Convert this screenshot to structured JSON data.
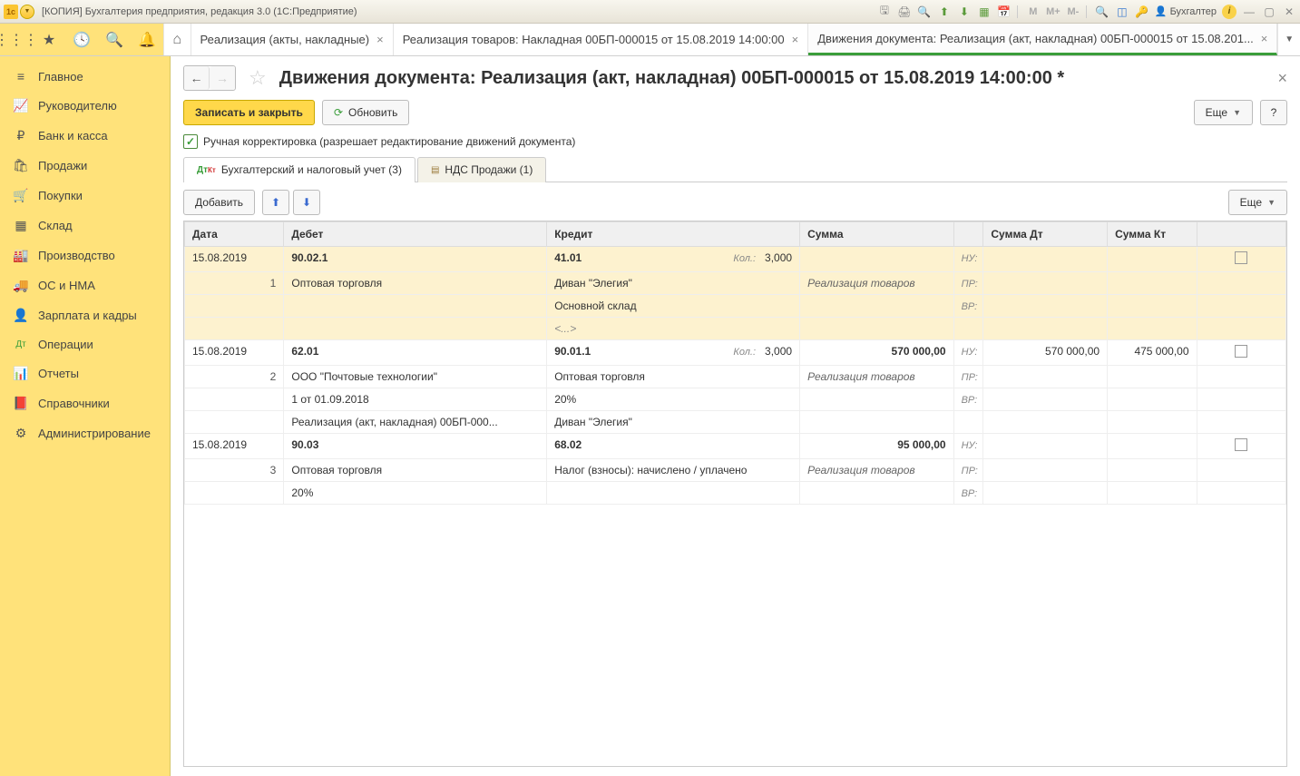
{
  "titlebar": {
    "title": "[КОПИЯ] Бухгалтерия предприятия, редакция 3.0  (1С:Предприятие)",
    "user": "Бухгалтер",
    "m_labels": [
      "M",
      "M+",
      "M-"
    ]
  },
  "open_tabs": [
    {
      "label": "Реализация (акты, накладные)",
      "closable": true
    },
    {
      "label": "Реализация товаров: Накладная 00БП-000015 от 15.08.2019 14:00:00",
      "closable": true
    },
    {
      "label": "Движения документа: Реализация (акт, накладная) 00БП-000015 от 15.08.201...",
      "closable": true,
      "active": true
    }
  ],
  "sidebar": [
    {
      "icon": "≡",
      "label": "Главное"
    },
    {
      "icon": "📈",
      "label": "Руководителю"
    },
    {
      "icon": "₽",
      "label": "Банк и касса"
    },
    {
      "icon": "🛍",
      "label": "Продажи"
    },
    {
      "icon": "🛒",
      "label": "Покупки"
    },
    {
      "icon": "▦",
      "label": "Склад"
    },
    {
      "icon": "🏭",
      "label": "Производство"
    },
    {
      "icon": "🚚",
      "label": "ОС и НМА"
    },
    {
      "icon": "👤",
      "label": "Зарплата и кадры"
    },
    {
      "icon": "Дт",
      "label": "Операции"
    },
    {
      "icon": "📊",
      "label": "Отчеты"
    },
    {
      "icon": "📕",
      "label": "Справочники"
    },
    {
      "icon": "⚙",
      "label": "Администрирование"
    }
  ],
  "page": {
    "title": "Движения документа: Реализация (акт, накладная) 00БП-000015 от 15.08.2019 14:00:00 *",
    "save_close": "Записать и закрыть",
    "refresh": "Обновить",
    "more": "Еще",
    "help": "?",
    "manual_edit": "Ручная корректировка (разрешает редактирование движений документа)",
    "subtabs": [
      "Бухгалтерский и налоговый учет (3)",
      "НДС Продажи (1)"
    ],
    "add": "Добавить"
  },
  "table": {
    "headers": {
      "date": "Дата",
      "debit": "Дебет",
      "credit": "Кредит",
      "sum": "Сумма",
      "sum_dt": "Сумма Дт",
      "sum_kt": "Сумма Кт"
    },
    "labels": {
      "kol": "Кол.:",
      "nu": "НУ:",
      "pr": "ПР:",
      "vr": "ВР:",
      "dots": "<...>"
    },
    "rows": [
      {
        "selected": true,
        "date": "15.08.2019",
        "num": "1",
        "dr_acc": "90.02.1",
        "dr_l1": "Оптовая торговля",
        "dr_l2": "",
        "dr_l3": "",
        "cr_acc": "41.01",
        "cr_kol": "3,000",
        "cr_l1": "Диван \"Элегия\"",
        "cr_l2": "Основной склад",
        "cr_l3_dots": true,
        "sum": "",
        "sum_note": "Реализация товаров",
        "sum_dt": "",
        "sum_kt": ""
      },
      {
        "selected": false,
        "date": "15.08.2019",
        "num": "2",
        "dr_acc": "62.01",
        "dr_l1": "ООО \"Почтовые  технологии\"",
        "dr_l2": "1 от 01.09.2018",
        "dr_l3": "Реализация (акт, накладная) 00БП-000...",
        "cr_acc": "90.01.1",
        "cr_kol": "3,000",
        "cr_l1": "Оптовая торговля",
        "cr_l2": "20%",
        "cr_l3": "Диван \"Элегия\"",
        "sum": "570 000,00",
        "sum_note": "Реализация товаров",
        "sum_dt": "570 000,00",
        "sum_kt": "475 000,00"
      },
      {
        "selected": false,
        "date": "15.08.2019",
        "num": "3",
        "dr_acc": "90.03",
        "dr_l1": "Оптовая торговля",
        "dr_l2": "20%",
        "dr_l3": "",
        "cr_acc": "68.02",
        "cr_kol": "",
        "cr_l1": "Налог (взносы): начислено / уплачено",
        "cr_l2": "",
        "cr_l3": "",
        "sum": "95 000,00",
        "sum_note": "Реализация товаров",
        "sum_dt": "",
        "sum_kt": ""
      }
    ]
  }
}
